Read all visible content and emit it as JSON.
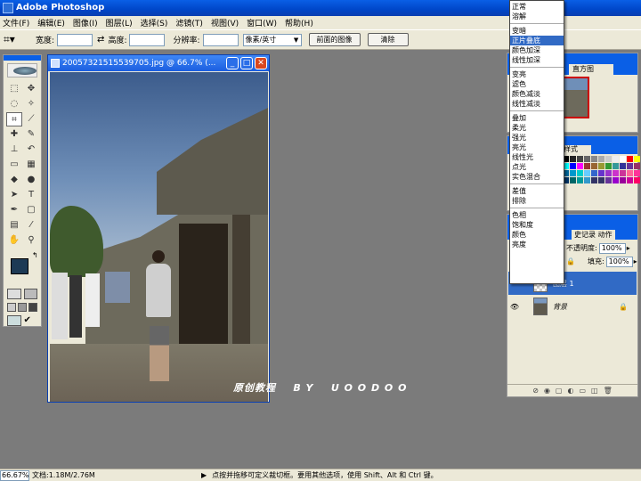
{
  "app": {
    "title": "Adobe Photoshop"
  },
  "menu": [
    "文件(F)",
    "编辑(E)",
    "图像(I)",
    "图层(L)",
    "选择(S)",
    "滤镜(T)",
    "视图(V)",
    "窗口(W)",
    "帮助(H)"
  ],
  "options": {
    "width_label": "宽度:",
    "height_label": "高度:",
    "resolution_label": "分辨率:",
    "unit_value": "像素/英寸",
    "front_image_button": "前面的图像",
    "clear_button": "清除"
  },
  "document": {
    "title": "20057321515539705.jpg @ 66.7% (..."
  },
  "watermark": "原创教程    B Y    U O O D O O",
  "blend_menu": [
    [
      "正常",
      "溶解"
    ],
    [
      "变暗",
      "正片叠底",
      "颜色加深",
      "线性加深"
    ],
    [
      "变亮",
      "滤色",
      "颜色减淡",
      "线性减淡"
    ],
    [
      "叠加",
      "柔光",
      "强光",
      "亮光",
      "线性光",
      "点光",
      "实色混合"
    ],
    [
      "差值",
      "排除"
    ],
    [
      "色相",
      "饱和度",
      "颜色",
      "亮度"
    ]
  ],
  "blend_menu_highlight": "正片叠底",
  "panels": {
    "navigator_tab": "直方图",
    "styles_tab": "样式",
    "layers_tabs": "史记录  动作",
    "opacity_label": "不透明度:",
    "opacity_value": "100%",
    "fill_label": "填充:",
    "fill_value": "100%",
    "layers": [
      {
        "name": "图层 1",
        "selected": true
      },
      {
        "name": "背景",
        "selected": false
      }
    ]
  },
  "status": {
    "zoom": "66.67%",
    "doc_size": "文档:1.18M/2.76M",
    "hint": "点按并拖移可定义裁切框。要用其他选项，使用 Shift、Alt 和 Ctrl 键。"
  }
}
